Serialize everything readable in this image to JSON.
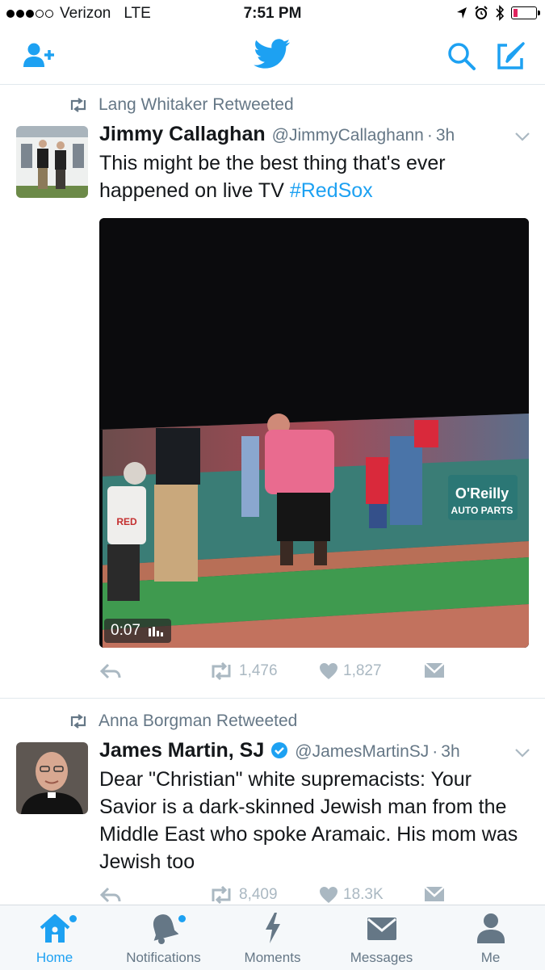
{
  "status_bar": {
    "carrier": "Verizon",
    "network": "LTE",
    "time": "7:51 PM",
    "signal_bars": 3,
    "signal_total": 5,
    "battery_level": 0.1
  },
  "nav": {
    "icons": [
      "add-user-icon",
      "twitter-bird-icon",
      "search-icon",
      "compose-icon"
    ],
    "accent": "#1da1f2"
  },
  "tweets": [
    {
      "retweeted_by": "Lang Whitaker Retweeted",
      "name": "Jimmy Callaghan",
      "handle": "@JimmyCallaghann",
      "sep": "·",
      "time": "3h",
      "text_main": "This might be the best thing that's ever happened on live TV ",
      "hashtag": "#RedSox",
      "video": {
        "duration": "0:07",
        "sign_brand": "O'Reilly",
        "sign_sub": "AUTO PARTS",
        "jersey": "RED"
      },
      "retweets": "1,476",
      "likes": "1,827"
    },
    {
      "retweeted_by": "Anna Borgman Retweeted",
      "name": "James Martin, SJ",
      "verified": true,
      "handle": "@JamesMartinSJ",
      "sep": "·",
      "time": "3h",
      "text": "Dear \"Christian\" white supremacists: Your Savior is a dark-skinned Jewish man from the Middle East who spoke Aramaic. His mom was Jewish too",
      "retweets": "8,409",
      "likes": "18.3K"
    }
  ],
  "tabbar": {
    "tabs": [
      {
        "label": "Home",
        "icon": "home-icon",
        "active": true,
        "badge": true
      },
      {
        "label": "Notifications",
        "icon": "bell-icon",
        "active": false,
        "badge": true
      },
      {
        "label": "Moments",
        "icon": "lightning-icon",
        "active": false,
        "badge": false
      },
      {
        "label": "Messages",
        "icon": "envelope-icon",
        "active": false,
        "badge": false
      },
      {
        "label": "Me",
        "icon": "person-icon",
        "active": false,
        "badge": false
      }
    ]
  }
}
